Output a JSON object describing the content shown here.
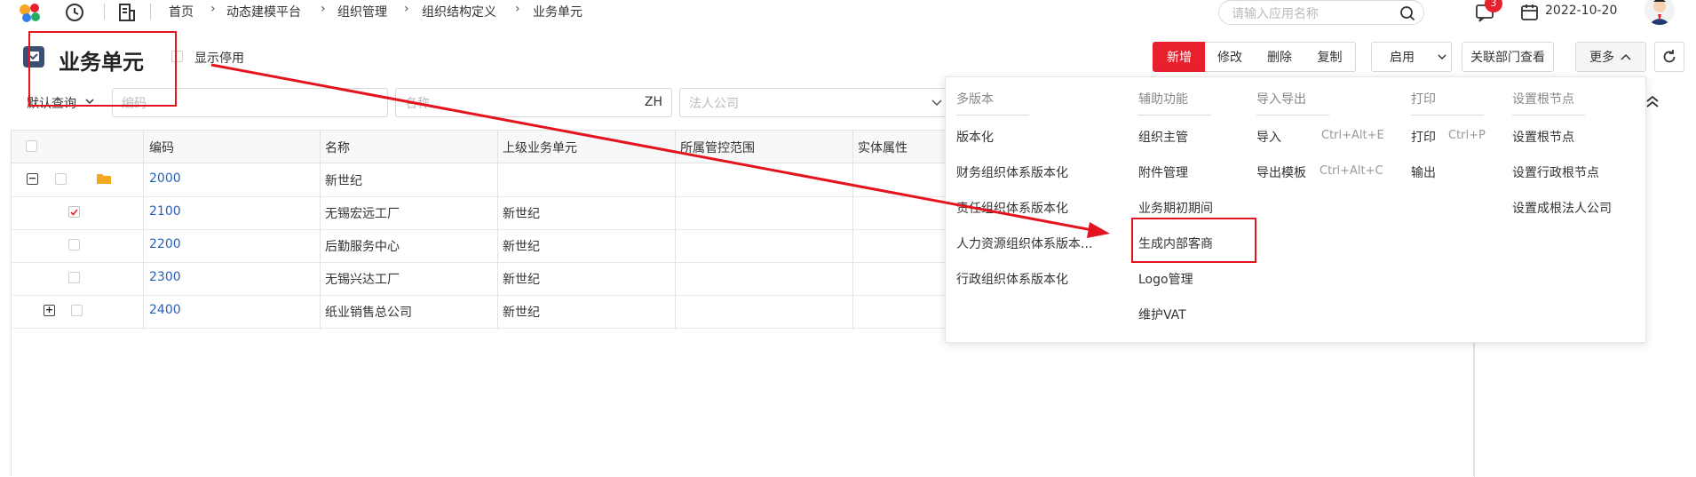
{
  "topbar": {
    "breadcrumb": [
      "首页",
      "动态建模平台",
      "组织管理",
      "组织结构定义",
      "业务单元"
    ],
    "search_placeholder": "请输入应用名称",
    "notification_count": "3",
    "date": "2022-10-20"
  },
  "header": {
    "title": "业务单元",
    "show_disabled_label": "显示停用",
    "buttons": {
      "new": "新增",
      "edit": "修改",
      "delete": "删除",
      "copy": "复制",
      "enable": "启用",
      "link_dept": "关联部门查看",
      "more": "更多"
    }
  },
  "filter": {
    "default_query": "默认查询",
    "code_placeholder": "编码",
    "name_placeholder": "名称",
    "lang": "ZH",
    "legal_company_placeholder": "法人公司"
  },
  "table": {
    "columns": [
      "编码",
      "名称",
      "上级业务单元",
      "所属管控范围",
      "实体属性"
    ],
    "rows": [
      {
        "code": "2000",
        "name": "新世纪",
        "parent": "",
        "checked": false
      },
      {
        "code": "2100",
        "name": "无锡宏远工厂",
        "parent": "新世纪",
        "checked": true
      },
      {
        "code": "2200",
        "name": "后勤服务中心",
        "parent": "新世纪",
        "checked": false
      },
      {
        "code": "2300",
        "name": "无锡兴达工厂",
        "parent": "新世纪",
        "checked": false
      },
      {
        "code": "2400",
        "name": "纸业销售总公司",
        "parent": "新世纪",
        "checked": false
      }
    ]
  },
  "more_menu": {
    "groups": [
      {
        "title": "多版本",
        "items": [
          "版本化",
          "财务组织体系版本化",
          "责任组织体系版本化",
          "人力资源组织体系版本...",
          "行政组织体系版本化"
        ]
      },
      {
        "title": "辅助功能",
        "items": [
          "组织主管",
          "附件管理",
          "业务期初期间",
          "生成内部客商",
          "Logo管理",
          "维护VAT"
        ]
      },
      {
        "title": "导入导出",
        "items": [
          "导入",
          "导出模板"
        ],
        "shortcuts": [
          "Ctrl+Alt+E",
          "Ctrl+Alt+C"
        ]
      },
      {
        "title": "打印",
        "items": [
          "打印",
          "输出"
        ],
        "shortcuts": [
          "Ctrl+P"
        ]
      },
      {
        "title": "设置根节点",
        "items": [
          "设置根节点",
          "设置行政根节点",
          "设置成根法人公司"
        ]
      }
    ]
  },
  "colors": {
    "accent": "#e8202e",
    "annotation": "#e4141f",
    "link": "#2a5fb8"
  }
}
